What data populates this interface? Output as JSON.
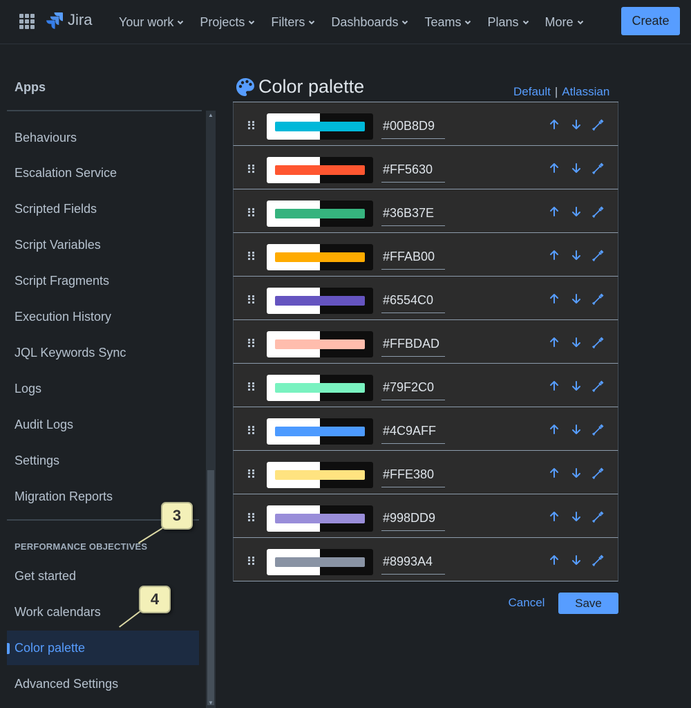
{
  "topnav": {
    "logo_text": "Jira",
    "items": [
      {
        "label": "Your work"
      },
      {
        "label": "Projects"
      },
      {
        "label": "Filters"
      },
      {
        "label": "Dashboards"
      },
      {
        "label": "Teams"
      },
      {
        "label": "Plans"
      },
      {
        "label": "More"
      }
    ],
    "create_label": "Create"
  },
  "sidebar": {
    "title": "Apps",
    "items": [
      {
        "label": "Behaviours"
      },
      {
        "label": "Escalation Service"
      },
      {
        "label": "Scripted Fields"
      },
      {
        "label": "Script Variables"
      },
      {
        "label": "Script Fragments"
      },
      {
        "label": "Execution History"
      },
      {
        "label": "JQL Keywords Sync"
      },
      {
        "label": "Logs"
      },
      {
        "label": "Audit Logs"
      },
      {
        "label": "Settings"
      },
      {
        "label": "Migration Reports"
      }
    ],
    "section_title": "PERFORMANCE OBJECTIVES",
    "section_items": [
      {
        "label": "Get started"
      },
      {
        "label": "Work calendars"
      },
      {
        "label": "Color palette",
        "active": true
      },
      {
        "label": "Advanced Settings"
      }
    ]
  },
  "callouts": [
    {
      "number": "3"
    },
    {
      "number": "4"
    }
  ],
  "main": {
    "title": "Color palette",
    "presets": {
      "default_label": "Default",
      "separator": "|",
      "atlassian_label": "Atlassian"
    },
    "colors": [
      {
        "hex": "#00B8D9"
      },
      {
        "hex": "#FF5630"
      },
      {
        "hex": "#36B37E"
      },
      {
        "hex": "#FFAB00"
      },
      {
        "hex": "#6554C0"
      },
      {
        "hex": "#FFBDAD"
      },
      {
        "hex": "#79F2C0"
      },
      {
        "hex": "#4C9AFF"
      },
      {
        "hex": "#FFE380"
      },
      {
        "hex": "#998DD9"
      },
      {
        "hex": "#8993A4"
      }
    ],
    "cancel_label": "Cancel",
    "save_label": "Save"
  },
  "theme": {
    "accent": "#579dff",
    "background": "#1d2125",
    "row_background": "#2c2c2c"
  },
  "icons": [
    "app-switcher-icon",
    "jira-logo-icon",
    "chevron-down-icon",
    "palette-icon",
    "drag-handle-icon",
    "arrow-up-icon",
    "arrow-down-icon",
    "eyedropper-icon"
  ]
}
